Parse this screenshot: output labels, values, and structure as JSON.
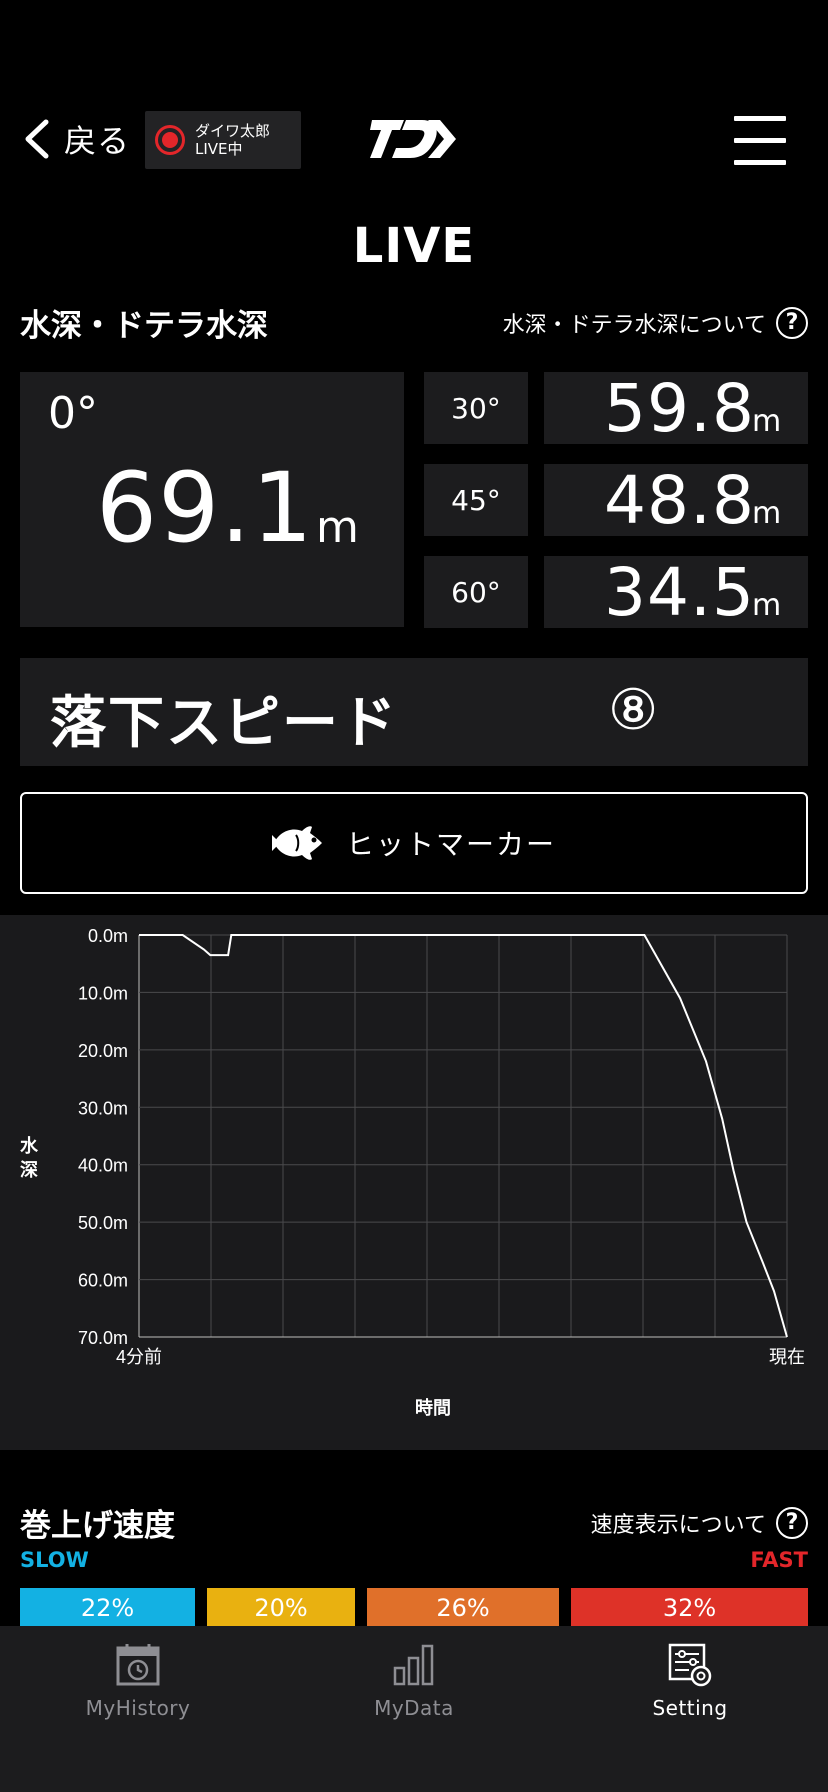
{
  "header": {
    "back_label": "戻る",
    "live_user": "ダイワ太郎",
    "live_status": "LIVE中"
  },
  "page_title": "LIVE",
  "depth_section": {
    "title": "水深・ドテラ水深",
    "help_label": "水深・ドテラ水深について",
    "help_icon": "?",
    "main": {
      "angle": "0°",
      "value": "69.1",
      "unit": "m"
    },
    "rows": [
      {
        "angle": "30°",
        "value": "59.8",
        "unit": "m"
      },
      {
        "angle": "45°",
        "value": "48.8",
        "unit": "m"
      },
      {
        "angle": "60°",
        "value": "34.5",
        "unit": "m"
      }
    ]
  },
  "fall_speed": {
    "label": "落下スピード",
    "value": "⑧"
  },
  "hit_marker": {
    "label": "ヒットマーカー",
    "icon": "fish-icon"
  },
  "chart_data": {
    "type": "line",
    "ylabel": "水深",
    "xlabel": "時間",
    "x_tick_labels": [
      "4分前",
      "現在"
    ],
    "y_tick_labels": [
      "0.0m",
      "10.0m",
      "20.0m",
      "30.0m",
      "40.0m",
      "50.0m",
      "60.0m",
      "70.0m"
    ],
    "ylim": [
      0,
      70
    ],
    "xlim": [
      -4,
      0
    ],
    "y_inverted": true,
    "grid": true,
    "series": [
      {
        "x": [
          -4.0,
          -3.73,
          -3.6,
          -3.56,
          -3.45,
          -3.43,
          -1.47,
          -0.88,
          -0.8,
          -0.66,
          -0.5,
          -0.4,
          -0.33,
          -0.25,
          -0.15,
          -0.15,
          -0.08,
          0.0
        ],
        "y": [
          0.0,
          0.0,
          2.5,
          3.5,
          3.5,
          0.0,
          0.0,
          0.0,
          4.0,
          11.0,
          22.0,
          32.0,
          41.0,
          50.0,
          57.0,
          57.0,
          62.0,
          70.0
        ]
      }
    ]
  },
  "reel_speed": {
    "title": "巻上げ速度",
    "help_label": "速度表示について",
    "help_icon": "?",
    "slow_label": "SLOW",
    "fast_label": "FAST",
    "bars": [
      {
        "label": "22%",
        "color": "#13b1e3"
      },
      {
        "label": "20%",
        "color": "#e9b110"
      },
      {
        "label": "26%",
        "color": "#e0702a"
      },
      {
        "label": "32%",
        "color": "#de3228"
      }
    ]
  },
  "tabs": [
    {
      "label": "MyHistory",
      "icon": "history-calendar-icon",
      "active": false
    },
    {
      "label": "MyData",
      "icon": "bar-chart-icon",
      "active": false
    },
    {
      "label": "Setting",
      "icon": "settings-icon",
      "active": true
    }
  ]
}
